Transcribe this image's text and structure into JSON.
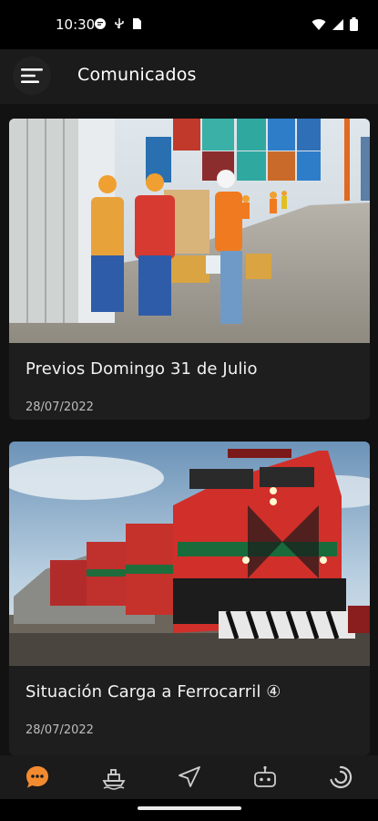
{
  "status_bar": {
    "time": "10:30",
    "left_icons": [
      "message-icon",
      "usb-icon",
      "sim-icon"
    ],
    "right_icons": [
      "wifi-icon",
      "signal-icon",
      "battery-icon"
    ]
  },
  "app_bar": {
    "menu_icon": "menu-icon",
    "title": "Comunicados"
  },
  "cards": [
    {
      "title": "Previos Domingo 31 de Julio",
      "date": "28/07/2022",
      "image": "workers-at-container-yard"
    },
    {
      "title": "Situación Carga a Ferrocarril ④",
      "date": "28/07/2022",
      "image": "red-freight-locomotive"
    }
  ],
  "bottom_nav": {
    "items": [
      {
        "icon": "chat-icon",
        "active": true
      },
      {
        "icon": "ship-icon",
        "active": false
      },
      {
        "icon": "navigation-icon",
        "active": false
      },
      {
        "icon": "robot-icon",
        "active": false
      },
      {
        "icon": "loading-icon",
        "active": false
      }
    ]
  },
  "colors": {
    "accent": "#f28b30",
    "background": "#121212",
    "surface": "#1e1e1e"
  }
}
